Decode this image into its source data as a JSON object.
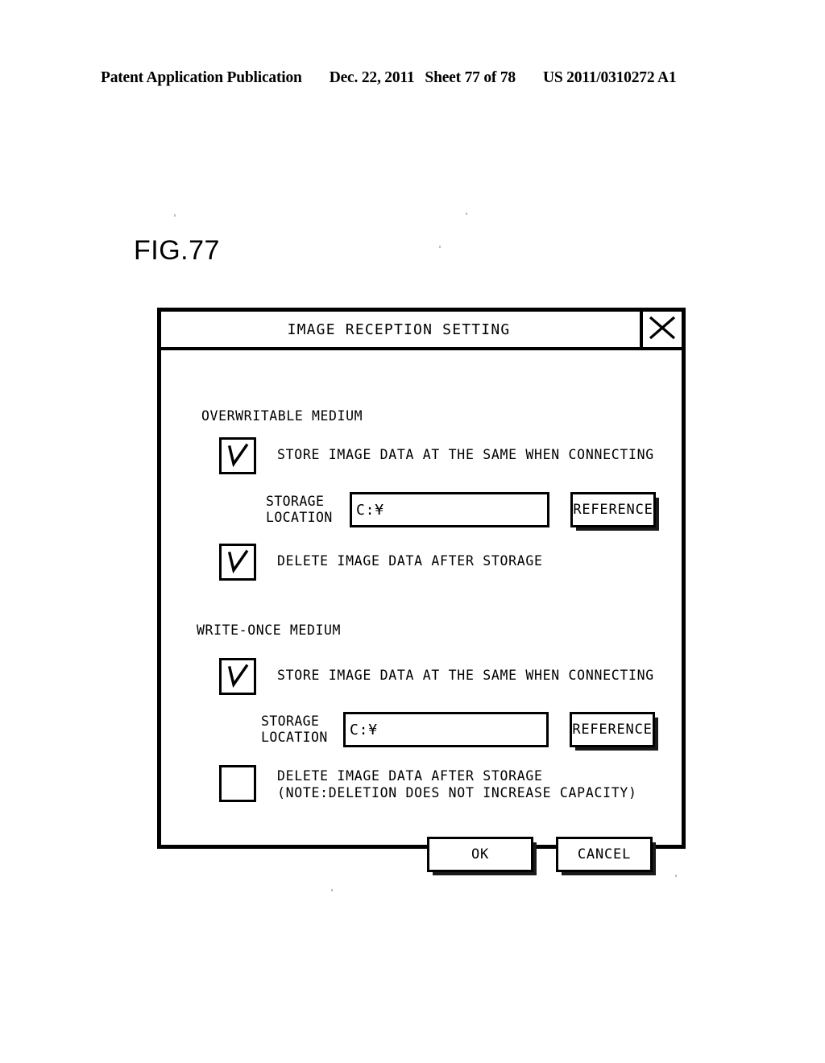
{
  "page_header": {
    "publication": "Patent Application Publication",
    "date": "Dec. 22, 2011",
    "sheet": "Sheet 77 of 78",
    "patent_number": "US 2011/0310272 A1"
  },
  "figure": {
    "label": "FIG.77"
  },
  "dialog": {
    "title": "IMAGE RECEPTION SETTING",
    "close_icon": "close-x-icon",
    "sections": [
      {
        "heading": "OVERWRITABLE MEDIUM",
        "store_checkbox": {
          "label": "STORE IMAGE DATA AT THE SAME WHEN CONNECTING",
          "checked": true,
          "check_icon": "checkmark-icon"
        },
        "storage": {
          "label_line1": "STORAGE",
          "label_line2": "LOCATION",
          "value": "C:¥",
          "placeholder": "",
          "reference_button": "REFERENCE"
        },
        "delete_checkbox": {
          "label_line1": "DELETE IMAGE DATA AFTER STORAGE",
          "label_line2": "",
          "checked": true,
          "check_icon": "checkmark-icon"
        }
      },
      {
        "heading": "WRITE-ONCE MEDIUM",
        "store_checkbox": {
          "label": "STORE IMAGE DATA AT THE SAME WHEN CONNECTING",
          "checked": true,
          "check_icon": "checkmark-icon"
        },
        "storage": {
          "label_line1": "STORAGE",
          "label_line2": "LOCATION",
          "value": "C:¥",
          "placeholder": "",
          "reference_button": "REFERENCE"
        },
        "delete_checkbox": {
          "label_line1": "DELETE IMAGE DATA AFTER STORAGE",
          "label_line2": "(NOTE:DELETION DOES NOT INCREASE CAPACITY)",
          "checked": false,
          "check_icon": "checkmark-icon"
        }
      }
    ],
    "footer": {
      "ok_label": "OK",
      "cancel_label": "CANCEL"
    }
  },
  "colors": {
    "ink": "#000000",
    "paper": "#ffffff",
    "button_shadow": "#1a1a1a"
  }
}
